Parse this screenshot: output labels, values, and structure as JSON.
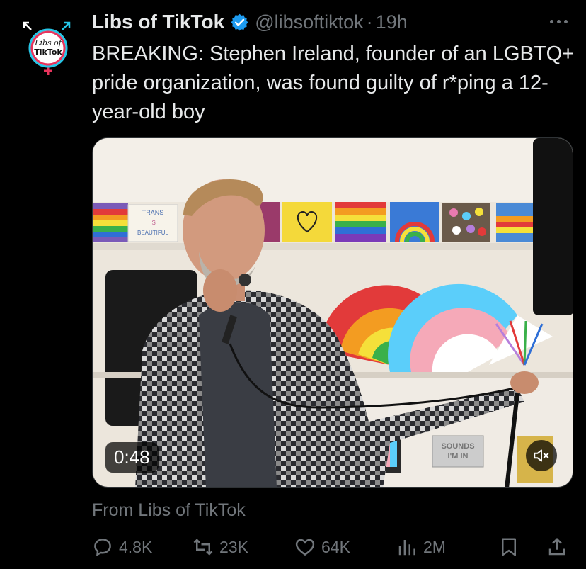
{
  "tweet": {
    "author_name": "Libs of TikTok",
    "handle": "@libsoftiktok",
    "separator": "·",
    "time": "19h",
    "text": "BREAKING: Stephen Ireland, founder of an LGBTQ+ pride organization, was found guilty of r*ping a 12-year-old boy",
    "avatar_text": [
      "Libs of",
      "TikTok"
    ],
    "media": {
      "duration": "0:48",
      "sign_text": [
        "TRANS",
        "IS",
        "BEAUTIFUL"
      ],
      "store_sign": [
        "SOUNDS",
        "I'M IN"
      ]
    },
    "attribution": "From Libs of TikTok",
    "actions": {
      "replies": "4.8K",
      "reposts": "23K",
      "likes": "64K",
      "views": "2M"
    }
  },
  "colors": {
    "background": "#000000",
    "text_primary": "#e7e9ea",
    "text_secondary": "#71767b",
    "verified_blue": "#1d9bf0"
  },
  "icons": [
    "verified-badge-icon",
    "more-icon",
    "mute-icon",
    "reply-icon",
    "repost-icon",
    "like-icon",
    "views-icon",
    "bookmark-icon",
    "share-icon"
  ]
}
